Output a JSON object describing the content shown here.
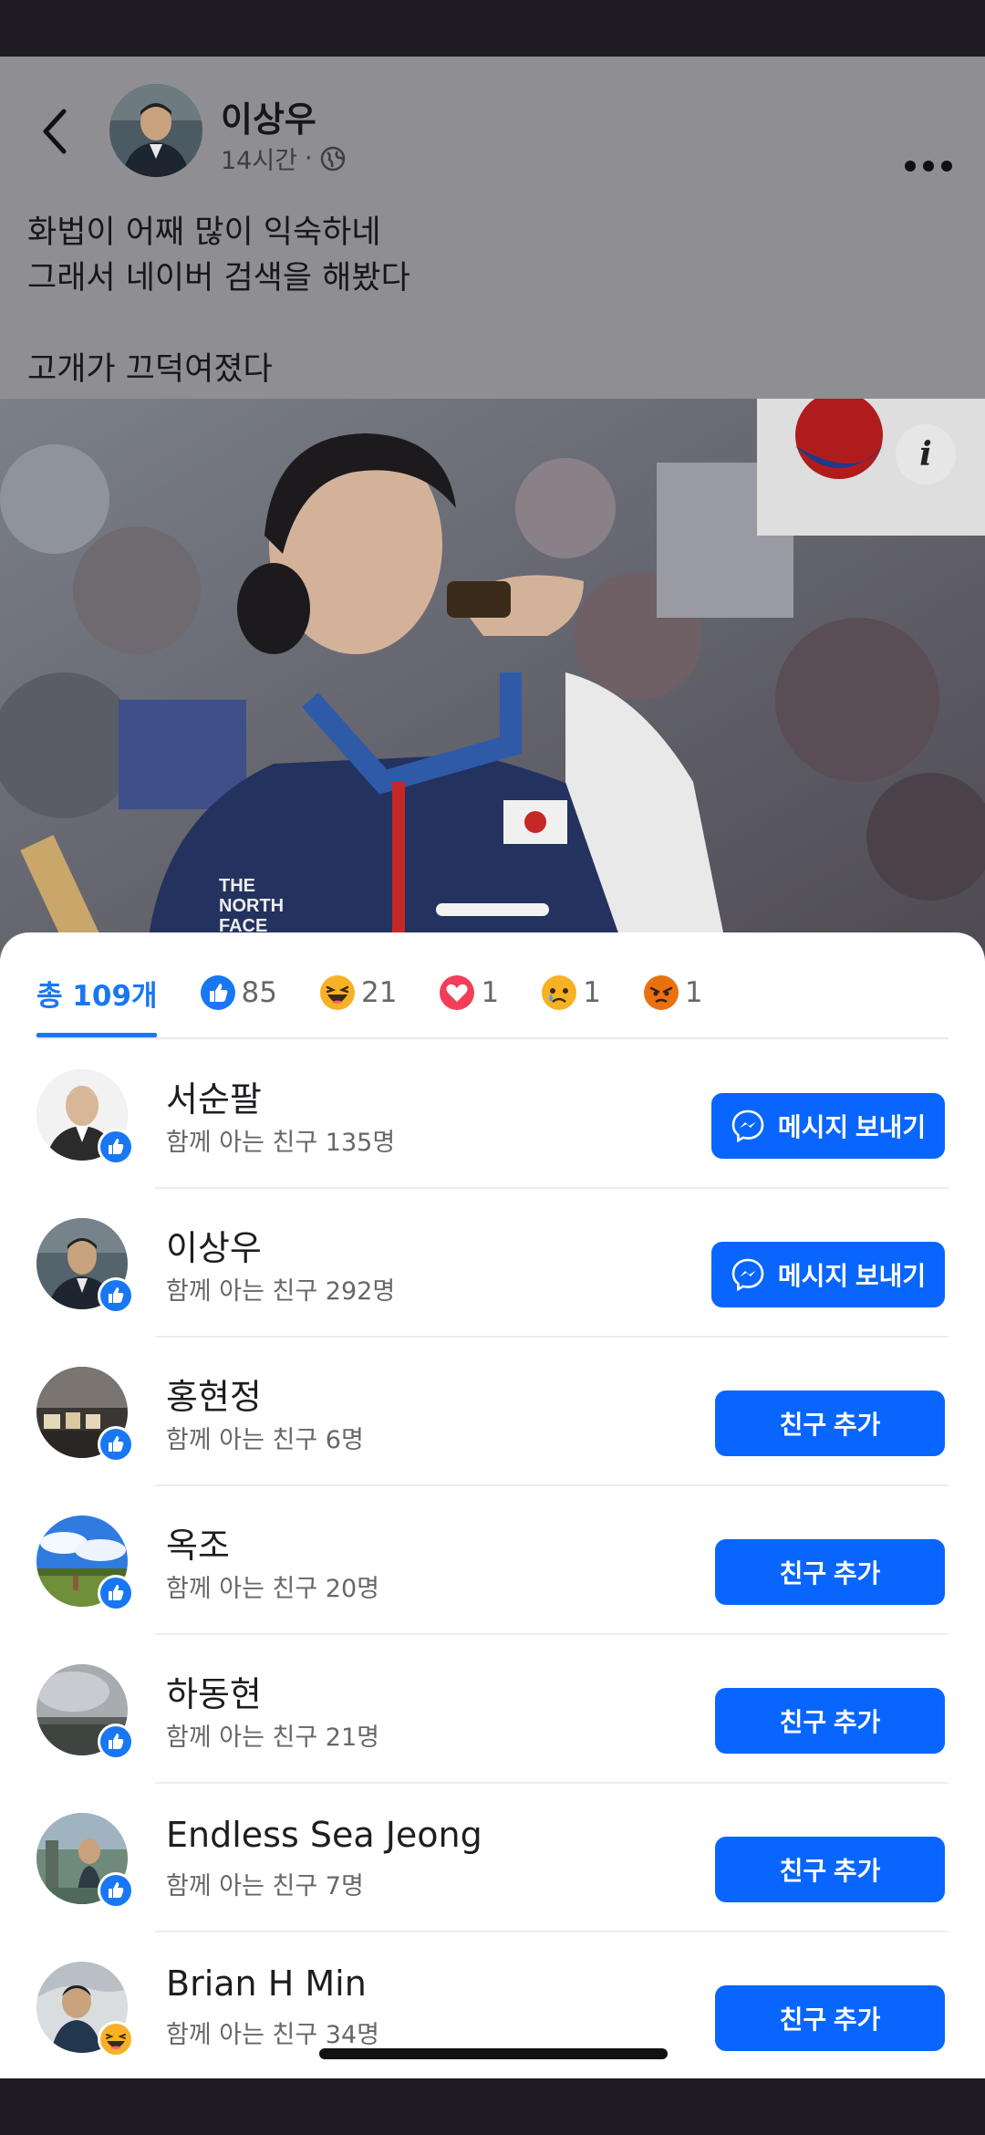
{
  "post": {
    "author_name": "이상우",
    "time": "14시간",
    "separator": "·",
    "text": "화법이 어째 많이 익숙하네\n그래서 네이버 검색을 해봤다\n\n고개가 끄덕여졌다",
    "icons": {
      "back": "chevron-left-icon",
      "privacy": "globe-icon",
      "more": "more-dots-icon",
      "info": "info-icon"
    }
  },
  "reactions": {
    "tabs": [
      {
        "label": "총 109개",
        "icon": ""
      },
      {
        "label": "85",
        "icon": "like-icon"
      },
      {
        "label": "21",
        "icon": "haha-icon"
      },
      {
        "label": "1",
        "icon": "love-icon"
      },
      {
        "label": "1",
        "icon": "sad-icon"
      },
      {
        "label": "1",
        "icon": "angry-icon"
      }
    ],
    "people": [
      {
        "name": "서순팔",
        "mutual": "함께 아는 친구 135명",
        "reaction": "like-icon",
        "button": "메시지 보내기",
        "button_icon": "messenger-icon"
      },
      {
        "name": "이상우",
        "mutual": "함께 아는 친구 292명",
        "reaction": "like-icon",
        "button": "메시지 보내기",
        "button_icon": "messenger-icon"
      },
      {
        "name": "홍현정",
        "mutual": "함께 아는 친구 6명",
        "reaction": "like-icon",
        "button": "친구 추가"
      },
      {
        "name": "옥조",
        "mutual": "함께 아는 친구 20명",
        "reaction": "like-icon",
        "button": "친구 추가"
      },
      {
        "name": "하동현",
        "mutual": "함께 아는 친구 21명",
        "reaction": "like-icon",
        "button": "친구 추가"
      },
      {
        "name": "Endless Sea Jeong",
        "mutual": "함께 아는 친구 7명",
        "reaction": "like-icon",
        "button": "친구 추가"
      },
      {
        "name": "Brian H Min",
        "mutual": "함께 아는 친구 34명",
        "reaction": "haha-icon",
        "button": "친구 추가"
      }
    ]
  },
  "colors": {
    "accent": "#1877f2",
    "button": "#0866ff",
    "love": "#f33e58",
    "emoji": "#f7b125",
    "angry": "#e9710f"
  }
}
